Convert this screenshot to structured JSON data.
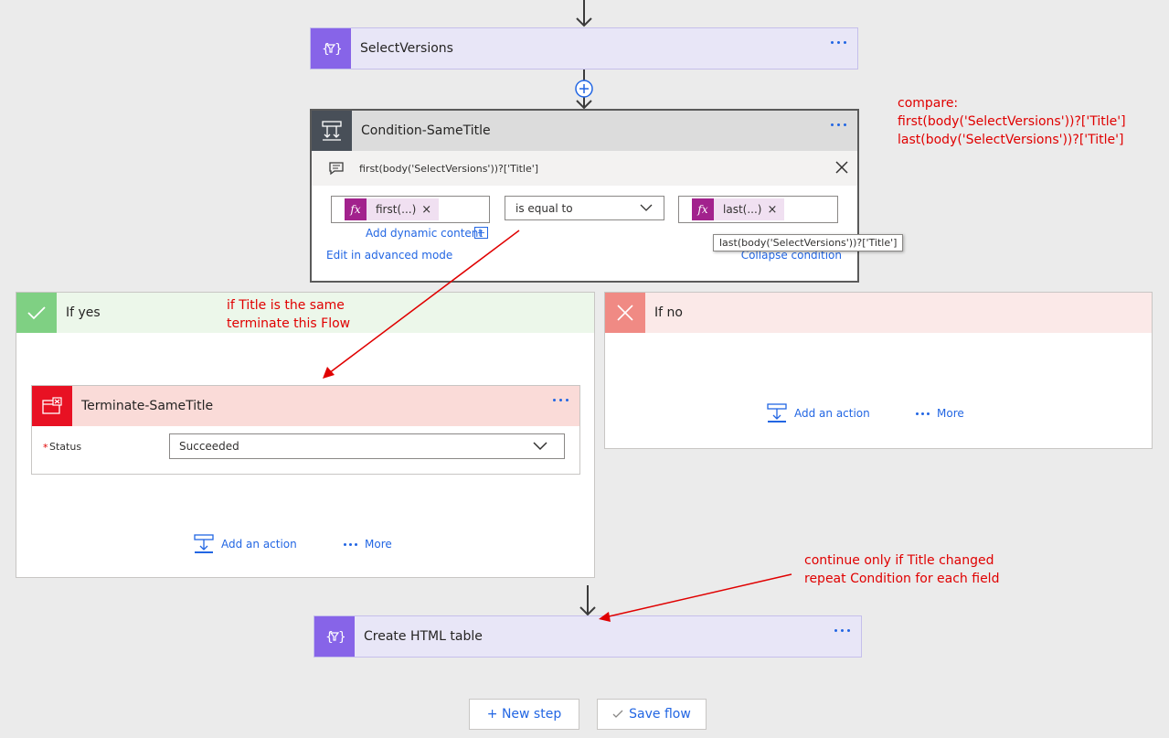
{
  "steps": {
    "select_versions": {
      "title": "SelectVersions"
    },
    "condition": {
      "title": "Condition-SameTitle",
      "comment": "first(body('SelectVersions'))?['Title']",
      "left_token": "first(...)",
      "operator": "is equal to",
      "right_token": "last(...)",
      "add_dynamic": "Add dynamic content",
      "advanced_mode": "Edit in advanced mode",
      "collapse": "Collapse condition",
      "tooltip": "last(body('SelectVersions'))?['Title']"
    },
    "if_yes": {
      "title": "If yes",
      "terminate": {
        "title": "Terminate-SameTitle",
        "status_label": "Status",
        "status_value": "Succeeded"
      },
      "add_action": "Add an action",
      "more": "More"
    },
    "if_no": {
      "title": "If no",
      "add_action": "Add an action",
      "more": "More"
    },
    "create_html": {
      "title": "Create HTML table"
    }
  },
  "footer": {
    "new_step": "+ New step",
    "save_flow": "Save flow"
  },
  "annotations": {
    "compare": [
      "compare:",
      "first(body('SelectVersions'))?['Title']",
      "last(body('SelectVersions'))?['Title']"
    ],
    "terminate_note": [
      "if Title is the same",
      "terminate this Flow"
    ],
    "continue_note": [
      "continue only if Title changed",
      "repeat Condition for each field"
    ]
  },
  "colors": {
    "purple": "#8764e8",
    "condition_dark": "#484f58",
    "yes_green": "#7fd083",
    "no_red": "#f08a84",
    "terminate_red": "#e81123",
    "annotation_red": "#e00000",
    "link_blue": "#2266e3"
  },
  "icons": [
    "filter-icon",
    "condition-icon",
    "comment-icon",
    "close-icon",
    "checkmark-icon",
    "x-icon",
    "terminate-icon",
    "chevron-down-icon",
    "add-action-icon",
    "plus-circle-icon",
    "checkmark-save-icon",
    "down-arrow-icon",
    "add-expression-icon",
    "more-dots-icon"
  ]
}
